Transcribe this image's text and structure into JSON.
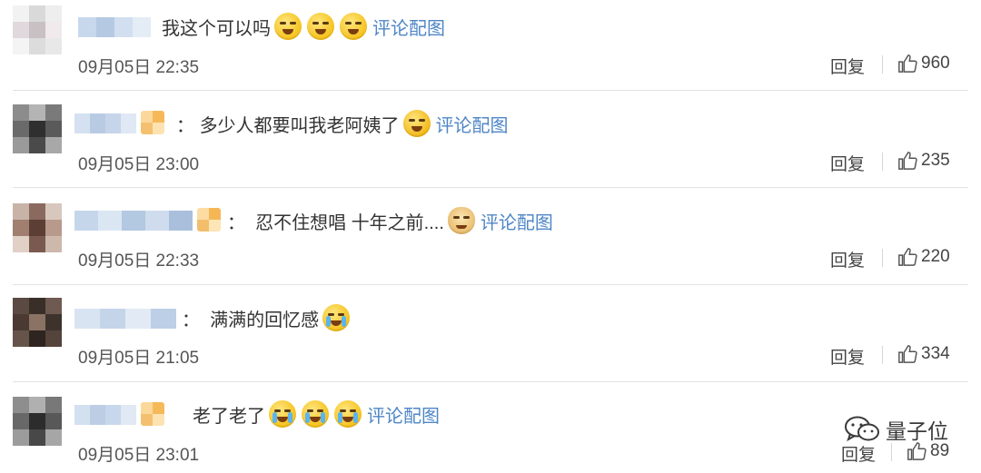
{
  "comments": [
    {
      "text": "我这个可以吗",
      "emojis": [
        "laugh",
        "laugh",
        "laugh"
      ],
      "link": "评论配图",
      "time": "09月05日 22:35",
      "reply": "回复",
      "likes": "960"
    },
    {
      "text": "多少人都要叫我老阿姨了",
      "emojis": [
        "laugh"
      ],
      "link": "评论配图",
      "time": "09月05日 23:00",
      "reply": "回复",
      "likes": "235"
    },
    {
      "text": "忍不住想唱 十年之前....",
      "emojis": [
        "doge"
      ],
      "link": "评论配图",
      "time": "09月05日 22:33",
      "reply": "回复",
      "likes": "220"
    },
    {
      "text": "满满的回忆感",
      "emojis": [
        "cry"
      ],
      "link": "",
      "time": "09月05日 21:05",
      "reply": "回复",
      "likes": "334"
    },
    {
      "text": "老了老了",
      "emojis": [
        "cry",
        "cry",
        "cry"
      ],
      "link": "评论配图",
      "time": "09月05日 23:01",
      "reply": "回复",
      "likes": "89"
    }
  ],
  "watermark": {
    "label": "量子位",
    "icon": "wechat-icon"
  },
  "icons": {
    "like": "thumbs-up-icon"
  },
  "colors": {
    "link": "#4f86c6",
    "divider": "#e2e2e2",
    "text": "#333333"
  }
}
